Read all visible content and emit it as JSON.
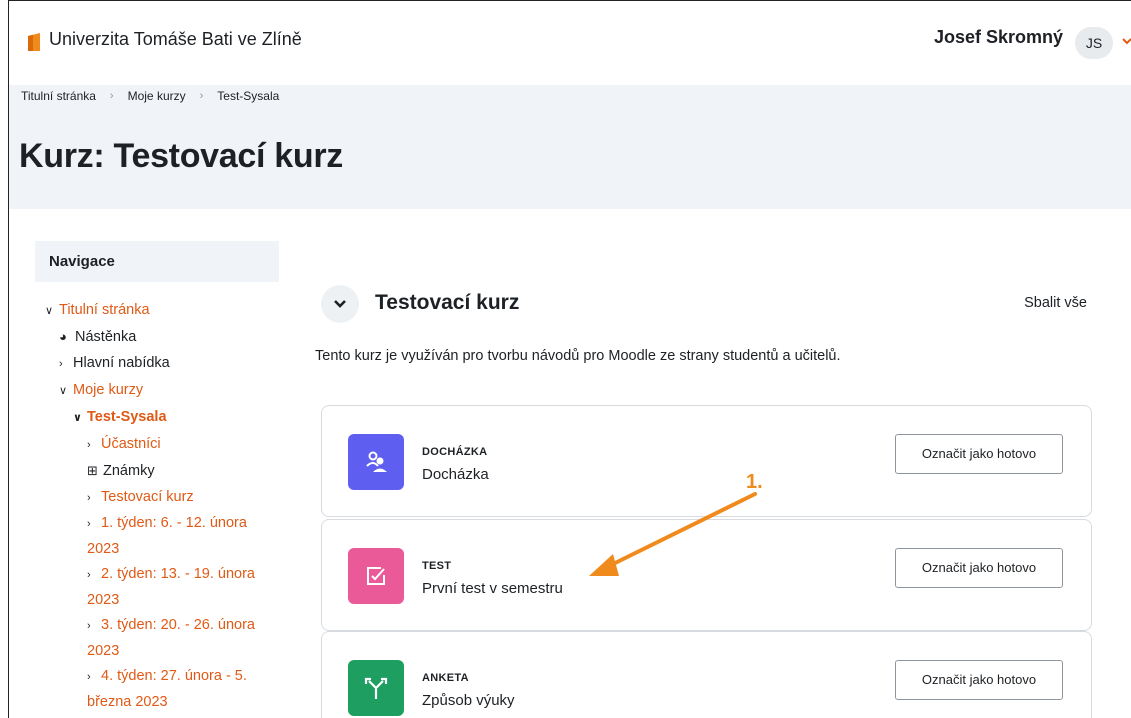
{
  "navbar": {
    "site_name": "Univerzita Tomáše Bati ve Zlíně",
    "user_name": "Josef Skromný",
    "avatar_initials": "JS"
  },
  "breadcrumb": [
    "Titulní stránka",
    "Moje kurzy",
    "Test-Sysala"
  ],
  "page_title": "Kurz: Testovací kurz",
  "sidebar": {
    "title": "Navigace",
    "items": [
      {
        "label": "Titulní stránka"
      },
      {
        "label": "Nástěnka",
        "icon": "dashboard-icon"
      },
      {
        "label": "Hlavní nabídka"
      },
      {
        "label": "Moje kurzy"
      },
      {
        "label": "Test-Sysala"
      },
      {
        "label": "Účastníci"
      },
      {
        "label": "Známky",
        "icon": "table-icon"
      },
      {
        "label": "Testovací kurz"
      },
      {
        "label": "1. týden: 6. - 12. února 2023"
      },
      {
        "label": "2. týden: 13. - 19. února 2023"
      },
      {
        "label": "3. týden: 20. - 26. února 2023"
      },
      {
        "label": "4. týden: 27. února - 5. března 2023"
      }
    ]
  },
  "main": {
    "section_title": "Testovací kurz",
    "collapse_all": "Sbalit vše",
    "summary": "Tento kurz je využíván pro tvorbu návodů pro Moodle ze strany studentů a učitelů.",
    "activities": [
      {
        "type": "DOCHÁZKA",
        "name": "Docházka",
        "button": "Označit jako hotovo",
        "color": "#5e5ef0",
        "icon": "attendance-icon"
      },
      {
        "type": "TEST",
        "name": "První test v semestru",
        "button": "Označit jako hotovo",
        "color": "#ea5a99",
        "icon": "quiz-icon"
      },
      {
        "type": "ANKETA",
        "name": "Způsob výuky",
        "button": "Označit jako hotovo",
        "color": "#1e9e61",
        "icon": "choice-icon"
      }
    ]
  },
  "annotation": {
    "label": "1.",
    "color": "#f08a1c"
  },
  "colors": {
    "accent": "#e05a16",
    "header_band": "#f0f3f7"
  }
}
